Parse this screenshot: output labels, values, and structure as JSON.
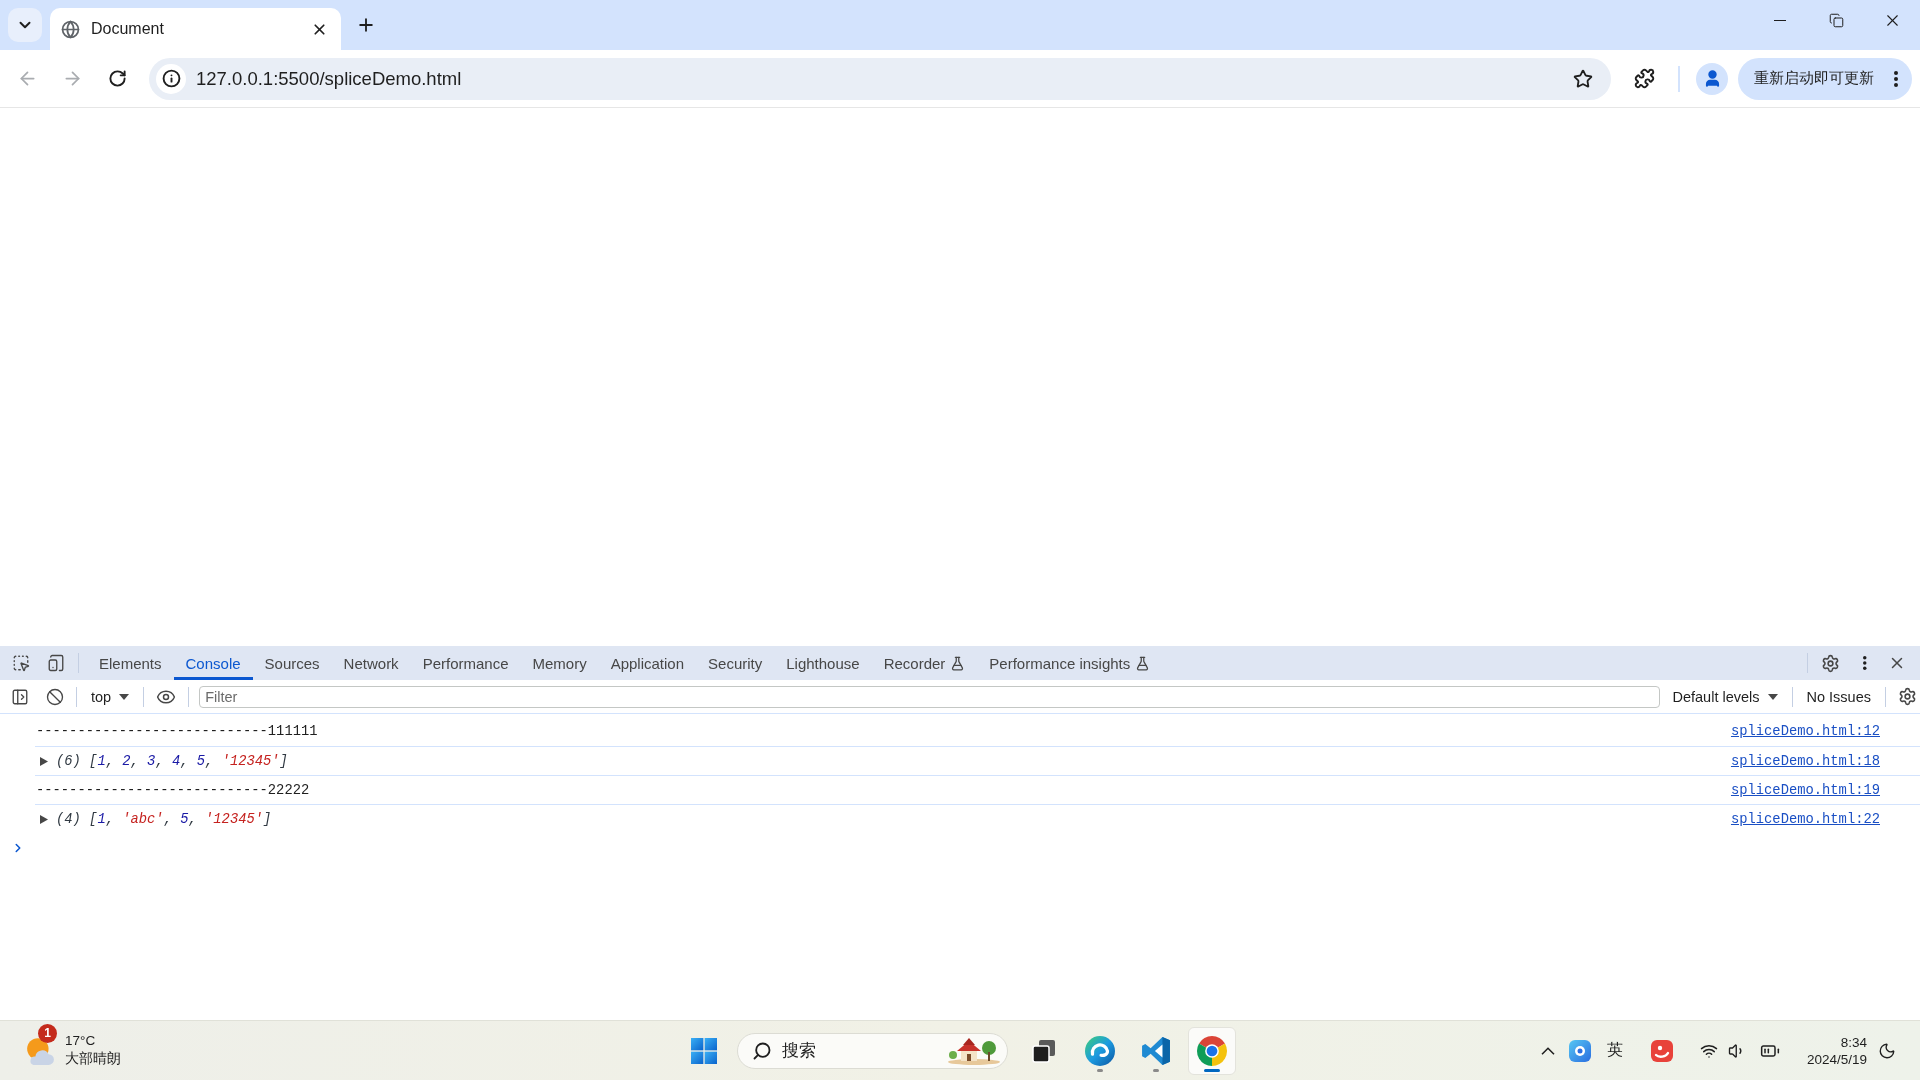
{
  "browser": {
    "tabs": [
      {
        "title": "Document",
        "selected": true
      }
    ],
    "back": {
      "disabled": true
    },
    "forward": {
      "disabled": true
    },
    "address": {
      "value": "127.0.0.1:5500/spliceDemo.html"
    },
    "update_button": "重新启动即可更新"
  },
  "devtools": {
    "tabs": [
      {
        "label": "Elements",
        "selected": false,
        "experimental": false
      },
      {
        "label": "Console",
        "selected": true,
        "experimental": false
      },
      {
        "label": "Sources",
        "selected": false,
        "experimental": false
      },
      {
        "label": "Network",
        "selected": false,
        "experimental": false
      },
      {
        "label": "Performance",
        "selected": false,
        "experimental": false
      },
      {
        "label": "Memory",
        "selected": false,
        "experimental": false
      },
      {
        "label": "Application",
        "selected": false,
        "experimental": false
      },
      {
        "label": "Security",
        "selected": false,
        "experimental": false
      },
      {
        "label": "Lighthouse",
        "selected": false,
        "experimental": false
      },
      {
        "label": "Recorder",
        "selected": false,
        "experimental": true
      },
      {
        "label": "Performance insights",
        "selected": false,
        "experimental": true
      }
    ],
    "console_toolbar": {
      "context": "top",
      "filter": {
        "placeholder": "Filter"
      },
      "levels": "Default levels",
      "issues": "No Issues"
    },
    "messages": [
      {
        "kind": "log",
        "text": "----------------------------111111",
        "source": "spliceDemo.html:12"
      },
      {
        "kind": "array",
        "expanded": false,
        "parts": [
          {
            "kind": "punct",
            "text": "(6) ["
          },
          {
            "kind": "number",
            "text": "1"
          },
          {
            "kind": "punct",
            "text": ", "
          },
          {
            "kind": "number",
            "text": "2"
          },
          {
            "kind": "punct",
            "text": ", "
          },
          {
            "kind": "number",
            "text": "3"
          },
          {
            "kind": "punct",
            "text": ", "
          },
          {
            "kind": "number",
            "text": "4"
          },
          {
            "kind": "punct",
            "text": ", "
          },
          {
            "kind": "number",
            "text": "5"
          },
          {
            "kind": "punct",
            "text": ", "
          },
          {
            "kind": "string",
            "text": "'12345'"
          },
          {
            "kind": "punct",
            "text": "]"
          }
        ],
        "source": "spliceDemo.html:18"
      },
      {
        "kind": "log",
        "text": "----------------------------22222",
        "source": "spliceDemo.html:19"
      },
      {
        "kind": "array",
        "expanded": false,
        "parts": [
          {
            "kind": "punct",
            "text": "(4) ["
          },
          {
            "kind": "number",
            "text": "1"
          },
          {
            "kind": "punct",
            "text": ", "
          },
          {
            "kind": "string",
            "text": "'abc'"
          },
          {
            "kind": "punct",
            "text": ", "
          },
          {
            "kind": "number",
            "text": "5"
          },
          {
            "kind": "punct",
            "text": ", "
          },
          {
            "kind": "string",
            "text": "'12345'"
          },
          {
            "kind": "punct",
            "text": "]"
          }
        ],
        "source": "spliceDemo.html:22"
      }
    ]
  },
  "taskbar": {
    "weather": {
      "badge": "1",
      "temperature": "17°C",
      "condition": "大部晴朗"
    },
    "search": {
      "placeholder": "搜索"
    },
    "apps": [
      {
        "kind": "squares",
        "running": false,
        "selected": false
      },
      {
        "kind": "swirl",
        "running": true,
        "selected": false
      },
      {
        "kind": "ribbon",
        "running": true,
        "selected": false
      },
      {
        "kind": "ring",
        "running": true,
        "selected": true
      }
    ],
    "ime": "英",
    "clock": {
      "time": "8:34",
      "date": "2024/5/19"
    }
  }
}
